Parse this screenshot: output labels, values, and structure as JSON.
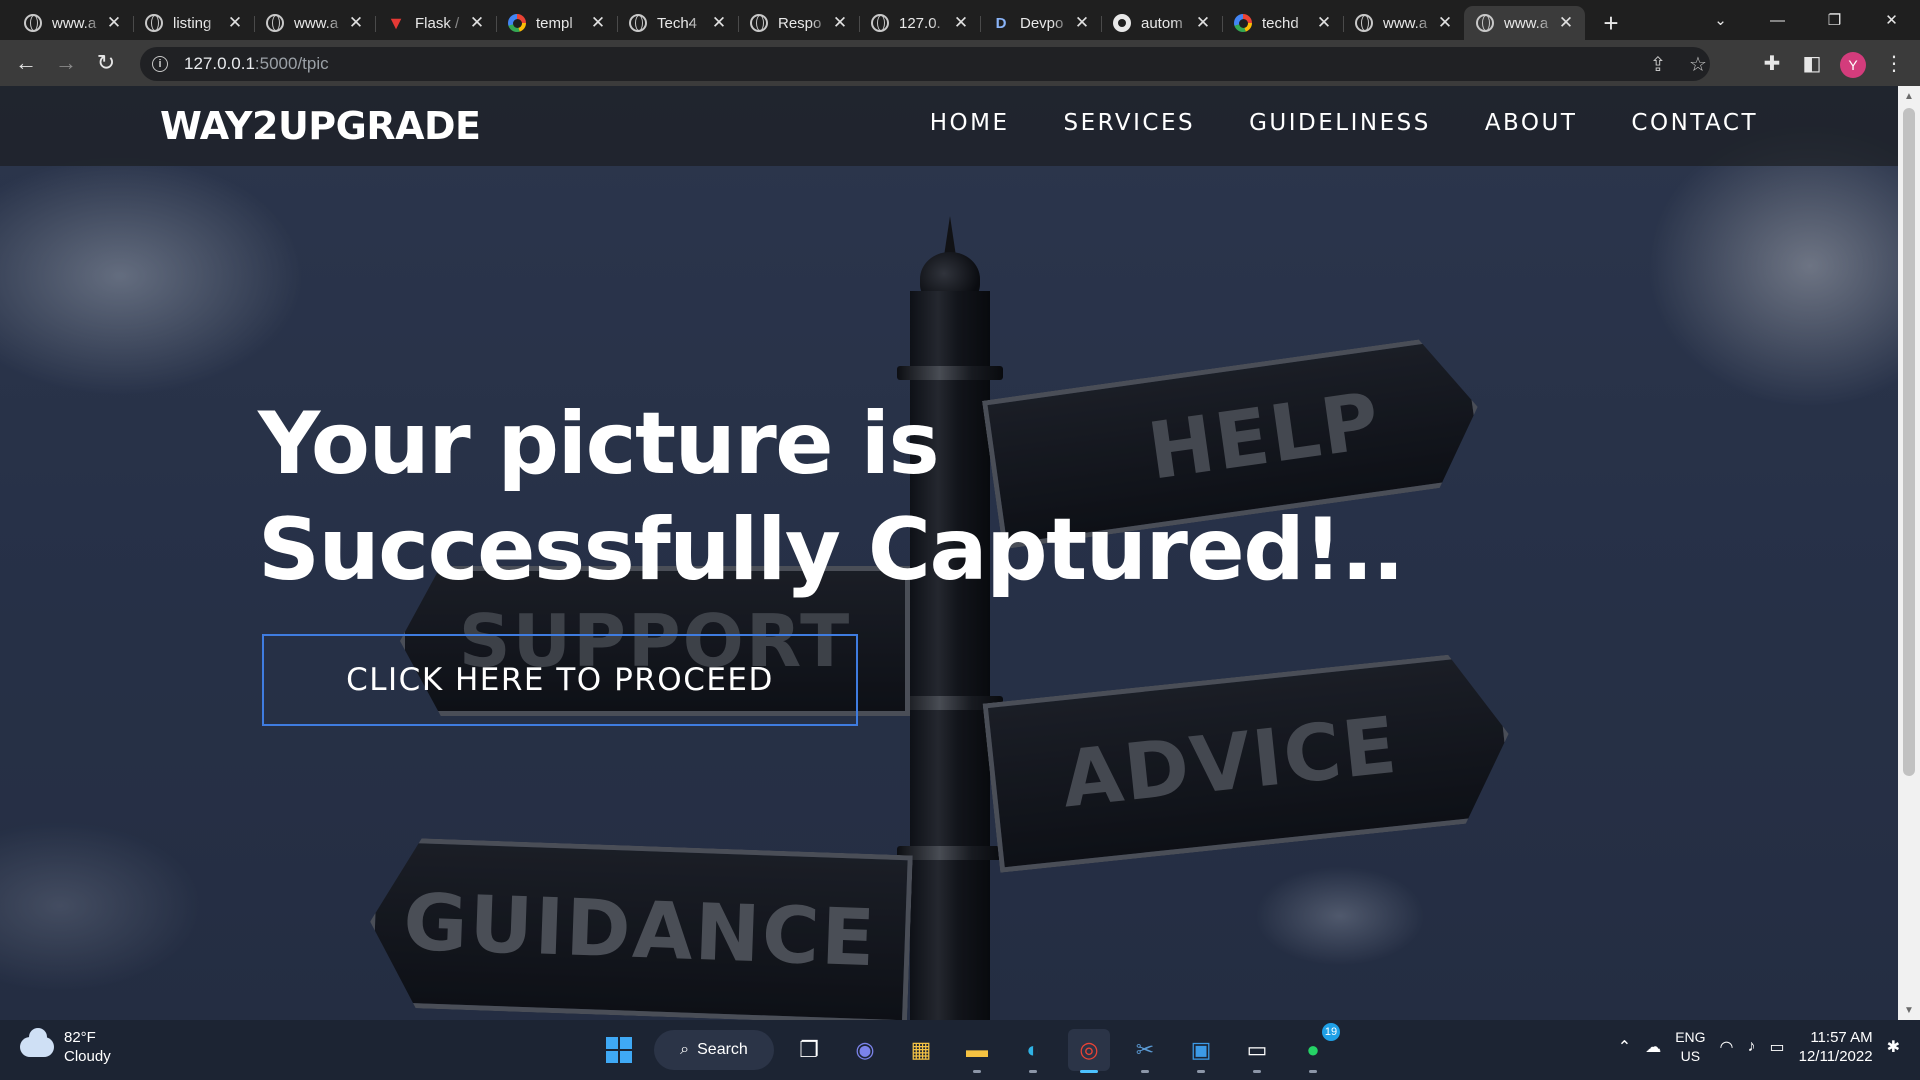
{
  "browser": {
    "tabs": [
      {
        "title": "www.a",
        "icon": "globe-icon"
      },
      {
        "title": "listing",
        "icon": "globe-icon"
      },
      {
        "title": "www.a",
        "icon": "globe-icon"
      },
      {
        "title": "Flask /",
        "icon": "flask-icon"
      },
      {
        "title": "templ",
        "icon": "google-icon"
      },
      {
        "title": "Tech4",
        "icon": "globe-icon"
      },
      {
        "title": "Respo",
        "icon": "globe-icon"
      },
      {
        "title": "127.0.",
        "icon": "globe-icon"
      },
      {
        "title": "Devpo",
        "icon": "devpost-icon"
      },
      {
        "title": "autom",
        "icon": "github-icon"
      },
      {
        "title": "techd",
        "icon": "google-icon"
      },
      {
        "title": "www.a",
        "icon": "globe-icon"
      },
      {
        "title": "www.a",
        "icon": "globe-icon"
      }
    ],
    "active_tab_index": 12,
    "address": {
      "host": "127.0.0.1",
      "path": ":5000/tpic"
    },
    "profile_initial": "Y",
    "profile_color": "#d33c7c"
  },
  "page": {
    "brand": "WAY2UPGRADE",
    "nav": [
      "HOME",
      "SERVICES",
      "GUIDELINESS",
      "ABOUT",
      "CONTACT"
    ],
    "headline_line1": "Your picture is",
    "headline_line2": "Successfully Captured!..",
    "cta_label": "CLICK HERE TO PROCEED",
    "cta_border_color": "#3f7ce0",
    "signs": [
      "HELP",
      "SUPPORT",
      "ADVICE",
      "GUIDANCE"
    ]
  },
  "taskbar": {
    "weather_temp": "82°F",
    "weather_desc": "Cloudy",
    "search_label": "Search",
    "whatsapp_badge": "19",
    "lang_line1": "ENG",
    "lang_line2": "US",
    "time": "11:57 AM",
    "date": "12/11/2022"
  }
}
